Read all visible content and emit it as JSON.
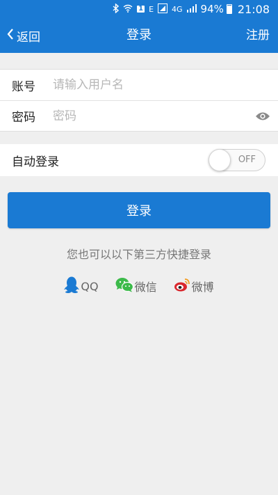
{
  "status_bar": {
    "sim_badge": "1",
    "network_e": "E",
    "network_4g": "4G",
    "battery": "94%",
    "time": "21:08"
  },
  "nav": {
    "back_label": "返回",
    "title": "登录",
    "register_label": "注册"
  },
  "form": {
    "account_label": "账号",
    "account_placeholder": "请输入用户名",
    "account_value": "",
    "password_label": "密码",
    "password_placeholder": "密码",
    "password_value": ""
  },
  "auto_login": {
    "label": "自动登录",
    "toggle_state": "OFF"
  },
  "login_button_label": "登录",
  "third_party": {
    "hint": "您也可以以下第三方快捷登录",
    "providers": [
      {
        "icon": "qq-icon",
        "label": "QQ",
        "color": "#1a7ad3"
      },
      {
        "icon": "wechat-icon",
        "label": "微信",
        "color": "#3cba4a"
      },
      {
        "icon": "weibo-icon",
        "label": "微博",
        "color": "#d9282e"
      }
    ]
  },
  "colors": {
    "accent": "#1a7ad3",
    "background": "#efefef"
  }
}
